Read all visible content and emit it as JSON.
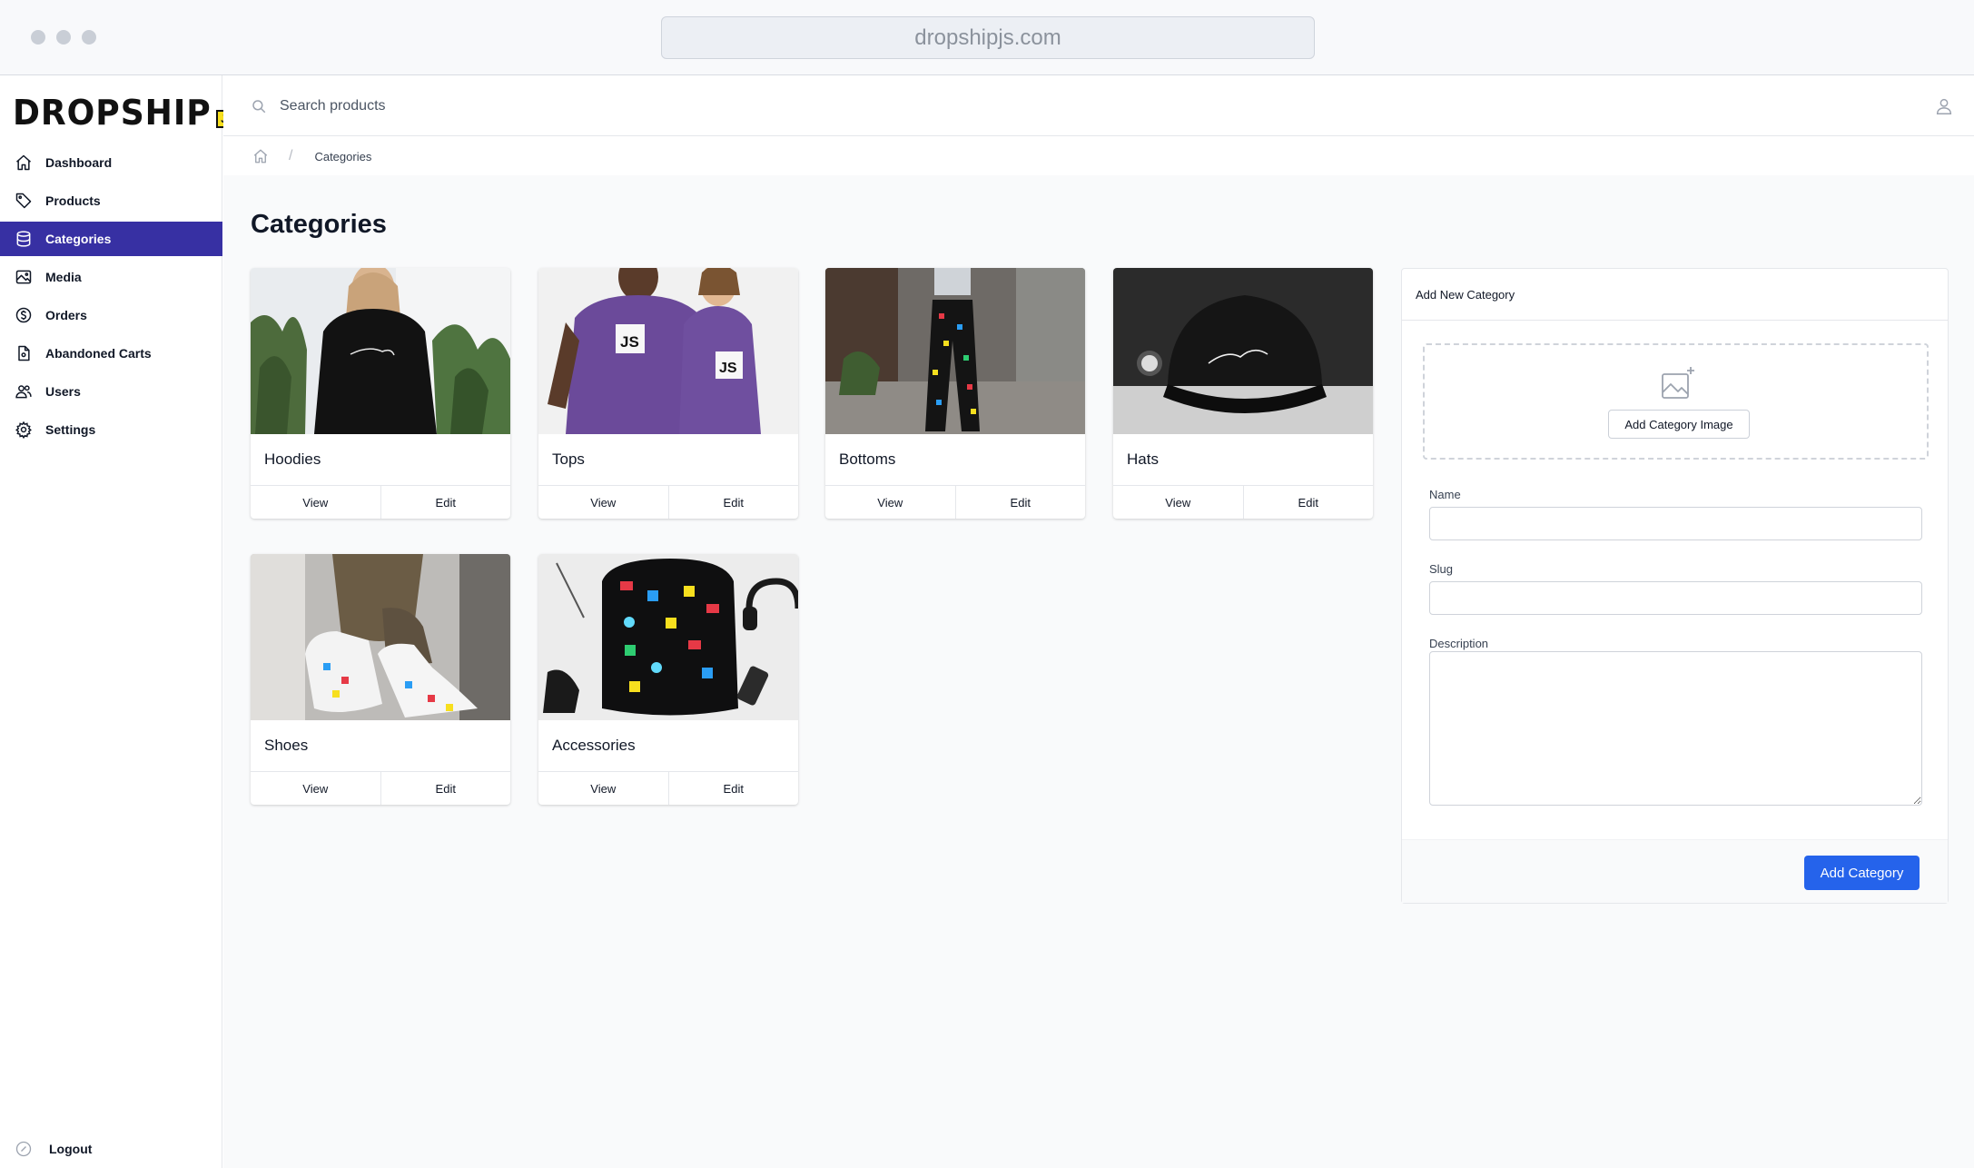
{
  "browser": {
    "url": "dropshipjs.com"
  },
  "logo": {
    "text": "DROPSHIP",
    "badge": "JS"
  },
  "sidebar": {
    "items": [
      {
        "label": "Dashboard",
        "icon": "home-icon"
      },
      {
        "label": "Products",
        "icon": "tag-icon"
      },
      {
        "label": "Categories",
        "icon": "database-icon",
        "active": true
      },
      {
        "label": "Media",
        "icon": "image-icon"
      },
      {
        "label": "Orders",
        "icon": "dollar-icon"
      },
      {
        "label": "Abandoned Carts",
        "icon": "document-icon"
      },
      {
        "label": "Users",
        "icon": "users-icon"
      },
      {
        "label": "Settings",
        "icon": "gear-icon"
      }
    ],
    "logout": "Logout"
  },
  "topbar": {
    "search_placeholder": "Search products"
  },
  "breadcrumb": {
    "current": "Categories"
  },
  "main": {
    "title": "Categories"
  },
  "categories": [
    {
      "name": "Hoodies",
      "view": "View",
      "edit": "Edit"
    },
    {
      "name": "Tops",
      "view": "View",
      "edit": "Edit"
    },
    {
      "name": "Bottoms",
      "view": "View",
      "edit": "Edit"
    },
    {
      "name": "Hats",
      "view": "View",
      "edit": "Edit"
    },
    {
      "name": "Shoes",
      "view": "View",
      "edit": "Edit"
    },
    {
      "name": "Accessories",
      "view": "View",
      "edit": "Edit"
    }
  ],
  "form": {
    "title": "Add New Category",
    "add_image": "Add Category Image",
    "name_label": "Name",
    "slug_label": "Slug",
    "description_label": "Description",
    "submit": "Add Category"
  },
  "colors": {
    "accent": "#3730a3",
    "primary_button": "#2563eb",
    "js_yellow": "#f7df1e"
  }
}
